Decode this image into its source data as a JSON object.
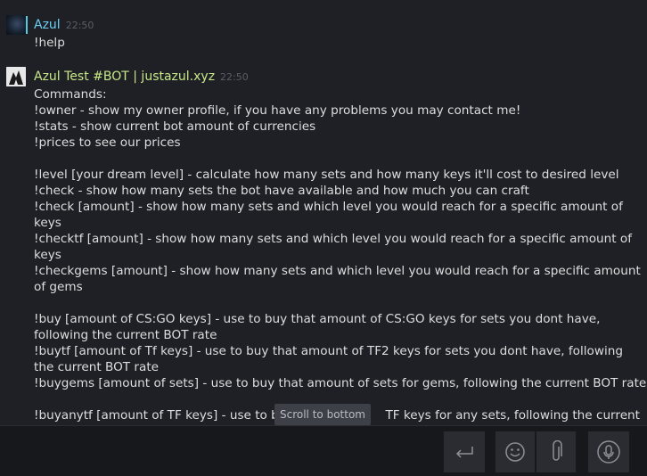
{
  "messages": [
    {
      "sender": "Azul",
      "time": "22:50",
      "lines": [
        "!help"
      ]
    },
    {
      "sender": "Azul Test #BOT | justazul.xyz",
      "time": "22:50",
      "lines": [
        "Commands:",
        "!owner - show my owner profile, if you have any problems you may contact me!",
        "!stats - show current bot amount of currencies",
        "!prices to see our prices",
        "",
        "!level [your dream level] - calculate how many sets and how many keys it'll cost to desired level",
        "!check - show how many sets the bot have available and how much you can craft",
        "!check [amount] - show how many sets and which level you would reach for a specific amount of",
        "keys",
        "!checktf [amount] - show how many sets and which level you would reach for a specific amount of",
        "keys",
        "!checkgems [amount] - show how many sets and which level you would reach for a specific amount",
        "of gems",
        "",
        "!buy [amount of CS:GO keys] - use to buy that amount of CS:GO keys for sets you dont have,",
        "following the current BOT rate",
        "!buytf [amount of Tf keys] - use to buy that amount of TF2 keys for sets you dont have, following",
        "the current BOT rate",
        "!buygems [amount of sets] - use to buy that amount of sets for gems, following the current BOT rate",
        "",
        "!buyanytf [amount of TF keys] - use to bu",
        "TF keys for any sets, following the current"
      ]
    }
  ],
  "tooltip": {
    "scroll_to_bottom": "Scroll to bottom"
  },
  "composer": {
    "input_value": "",
    "icons": {
      "send": "enter-arrow-icon",
      "emoji": "smiley-icon",
      "attach": "paperclip-icon",
      "voice": "microphone-icon"
    }
  },
  "colors": {
    "background": "#1e2025",
    "sender_user": "#6dcff6",
    "sender_bot": "#c9e888",
    "text": "#dcdedf",
    "timestamp": "#5a5d63"
  }
}
